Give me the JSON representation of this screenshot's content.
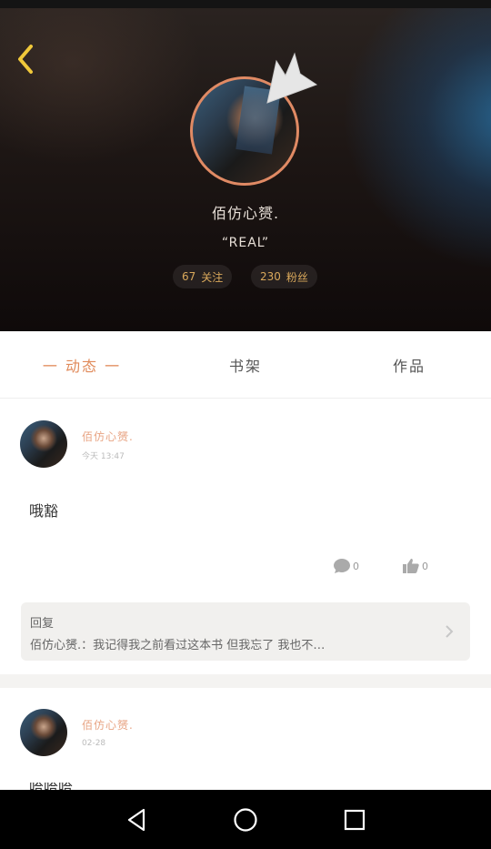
{
  "header": {
    "username": "佰仿心赟.",
    "signature": "“REAL”",
    "follow_count": "67",
    "follow_label": "关注",
    "fans_count": "230",
    "fans_label": "粉丝"
  },
  "tabs": [
    {
      "label": "一 动态 一",
      "active": true
    },
    {
      "label": "书架",
      "active": false
    },
    {
      "label": "作品",
      "active": false
    }
  ],
  "posts": [
    {
      "author": "佰仿心赟.",
      "time": "今天 13:47",
      "content": "哦豁",
      "comment_count": "0",
      "like_count": "0",
      "reply_label": "回复",
      "reply_text": "佰仿心赟.：我记得我之前看过这本书 但我忘了 我也不…"
    },
    {
      "author": "佰仿心赟.",
      "time": "02-28",
      "content": "哈哈哈"
    }
  ],
  "colors": {
    "accent": "#e08a5a",
    "name": "#e8a585",
    "stats": "#d9a85b",
    "avatar_ring": "#e08a64"
  },
  "icons": {
    "back": "chevron-left-icon",
    "comment": "comment-bubble-icon",
    "like": "thumbs-up-icon",
    "reply_more": "chevron-right-icon",
    "nav_back": "triangle-back-icon",
    "nav_home": "circle-home-icon",
    "nav_recent": "square-recent-icon"
  }
}
